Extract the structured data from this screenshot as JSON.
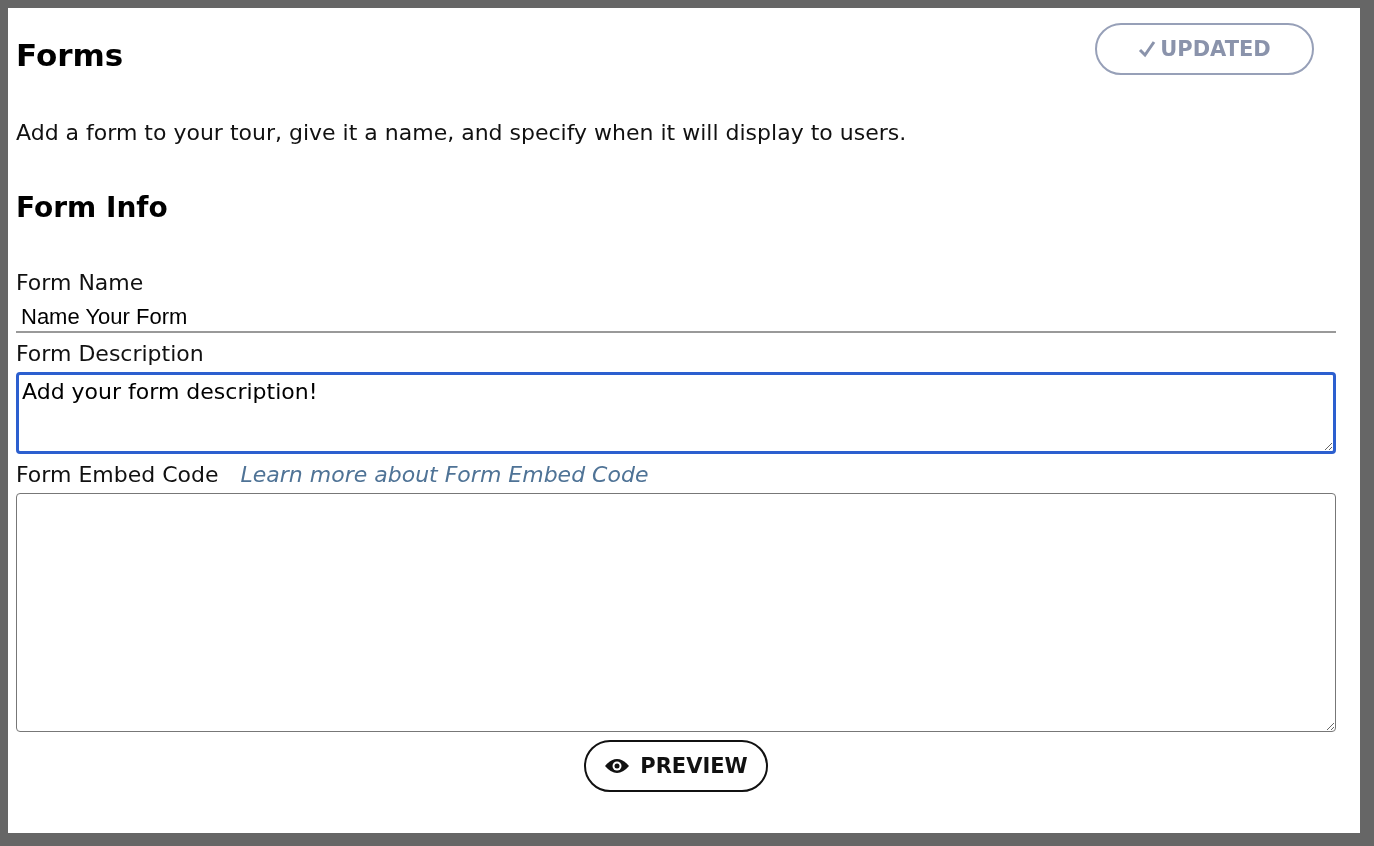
{
  "header": {
    "title": "Forms",
    "status_button": {
      "label": "UPDATED",
      "disabled": true
    }
  },
  "intro": "Add a form to your tour, give it a name, and specify when it will display to users.",
  "section_title": "Form Info",
  "fields": [
    {
      "kind": "line",
      "label": "Form Name",
      "value": "Name Your Form",
      "focused": false
    },
    {
      "kind": "area",
      "label": "Form Description",
      "value": "Add your form description!",
      "focused": true
    },
    {
      "kind": "code",
      "label": "Form Embed Code",
      "link": "Learn more about Form Embed Code",
      "focused": false
    }
  ],
  "preview_button": {
    "label": "PREVIEW"
  }
}
